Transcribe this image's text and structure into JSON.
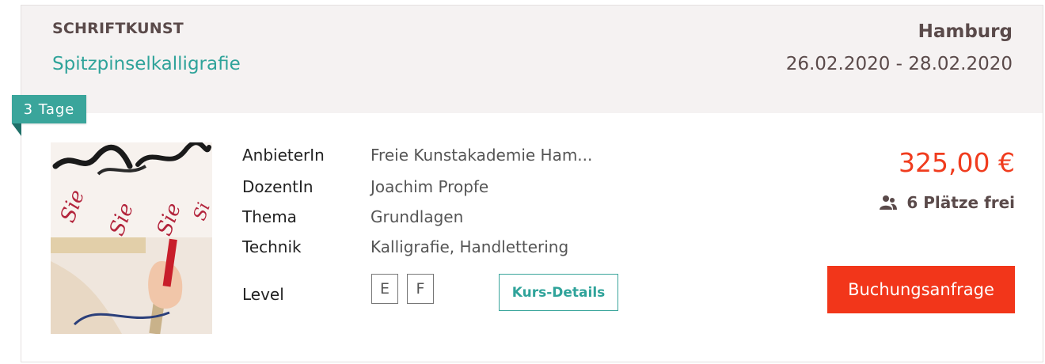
{
  "course": {
    "category": "SCHRIFTKUNST",
    "title": "Spitzpinselkalligrafie",
    "city": "Hamburg",
    "dates": "26.02.2020 - 28.02.2020",
    "duration_badge": "3 Tage"
  },
  "details": {
    "provider_label": "AnbieterIn",
    "provider_value": "Freie Kunstakademie Ham...",
    "teacher_label": "DozentIn",
    "teacher_value": "Joachim Propfe",
    "topic_label": "Thema",
    "topic_value": "Grundlagen",
    "technique_label": "Technik",
    "technique_value": "Kalligrafie, Handlettering",
    "level_label": "Level",
    "levels": [
      "E",
      "F"
    ],
    "details_button": "Kurs-Details"
  },
  "booking": {
    "price": "325,00 €",
    "seats": "6 Plätze frei",
    "seats_icon": "users-icon",
    "book_button": "Buchungsanfrage"
  },
  "colors": {
    "accent_teal": "#3aa59b",
    "price_red": "#f03c1e",
    "button_red": "#f2361a",
    "header_bg": "#f5f2f2"
  }
}
